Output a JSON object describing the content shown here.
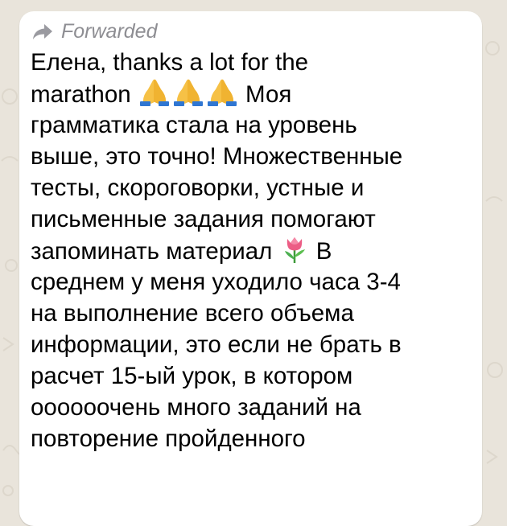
{
  "message": {
    "forwarded_label": "Forwarded",
    "lines": {
      "l1": "Елена, thanks a lot for the",
      "l2a": "marathon",
      "l2b": "Моя",
      "l3": "грамматика стала на уровень",
      "l4": "выше, это точно! Множественные",
      "l5": "тесты, скороговорки, устные и",
      "l6": "письменные задания помогают",
      "l7a": "запоминать материал",
      "l7b": "В",
      "l8": "среднем у меня уходило часа 3-4",
      "l9": "на выполнение всего объема",
      "l10": "информации, это если не брать в",
      "l11": "расчет 15-ый урок, в котором",
      "l12": "оооооочень много заданий на",
      "l13": "повторение пройденного"
    },
    "emojis": [
      "folded-hands",
      "folded-hands",
      "folded-hands",
      "tulip"
    ]
  },
  "colors": {
    "wallpaper": "#e9e4db",
    "bubble": "#ffffff",
    "forwarded_text": "#8e8e93",
    "message_text": "#000000"
  }
}
